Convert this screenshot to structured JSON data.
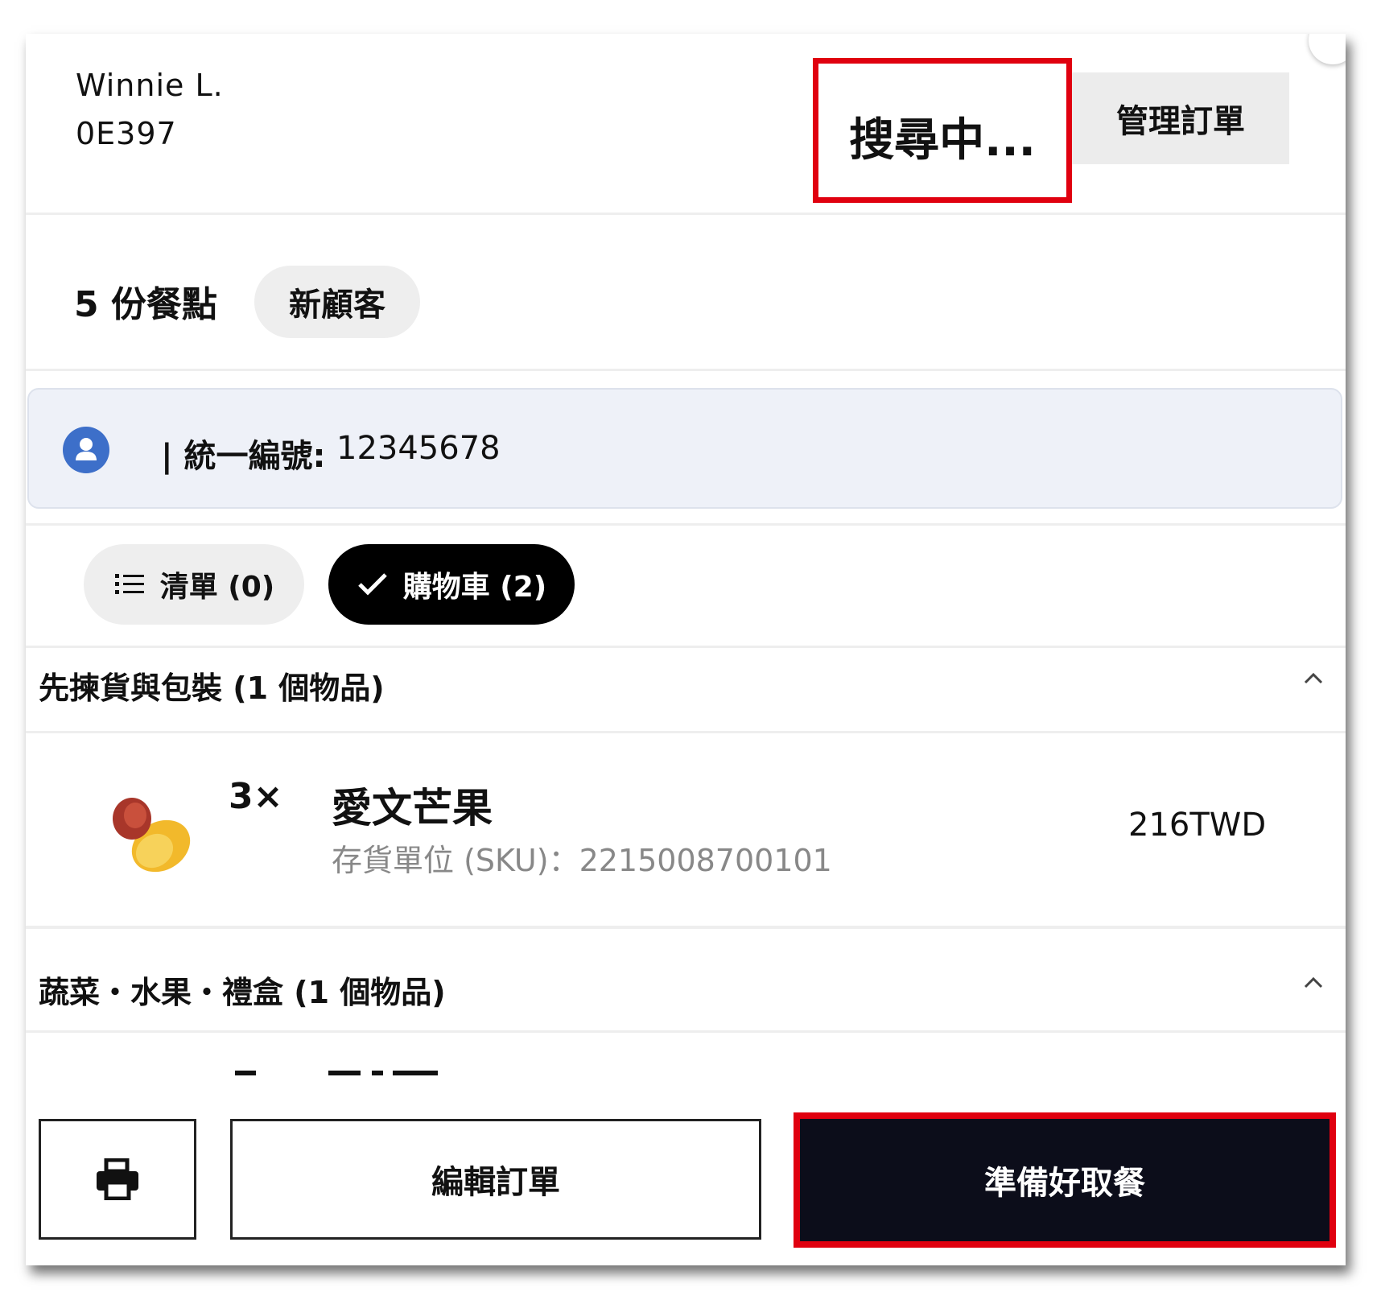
{
  "header": {
    "customer_name": "Winnie L.",
    "order_code": "0E397",
    "status": "搜尋中...",
    "manage_button": "管理訂單"
  },
  "summary": {
    "items_count": "5 份餐點",
    "customer_badge": "新顧客"
  },
  "tax": {
    "icon": "user-icon",
    "label": "| 統一編號:",
    "value": "12345678"
  },
  "tabs": [
    {
      "label": "清單 (0)",
      "icon": "list-icon"
    },
    {
      "label": "購物車 (2)",
      "icon": "check-icon"
    }
  ],
  "sections": [
    {
      "title": "先揀貨與包裝 (1 個物品)",
      "items": [
        {
          "icon": "mango-icon",
          "qty": "3×",
          "name": "愛文芒果",
          "sku": "存貨單位 (SKU)：2215008700101",
          "price": "216TWD"
        }
      ]
    },
    {
      "title": "蔬菜・水果・禮盒 (1 個物品)",
      "items": []
    }
  ],
  "footer": {
    "print_icon": "printer-icon",
    "edit_button": "編輯訂單",
    "ready_button": "準備好取餐"
  },
  "colors": {
    "highlight": "#e0000f",
    "primary_dark": "#0c0d1a",
    "info_bar": "#eef1f8",
    "avatar_blue": "#3d6fc9"
  }
}
